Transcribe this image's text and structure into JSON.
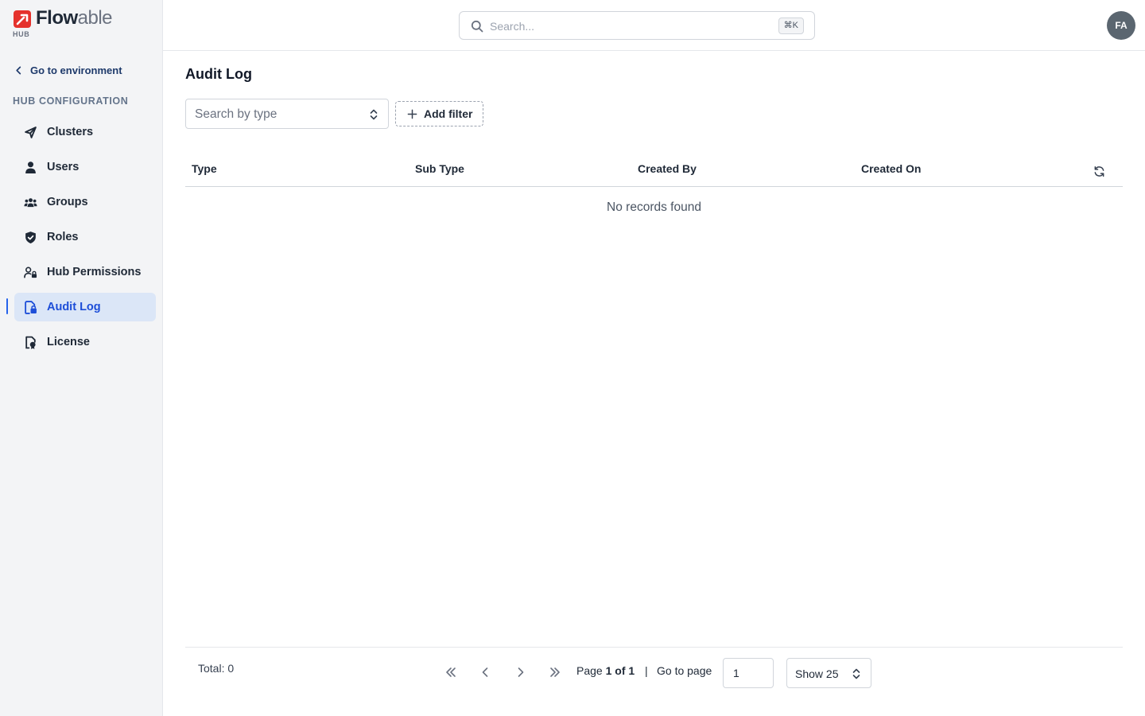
{
  "brand": {
    "name_strong": "Flow",
    "name_soft": "able",
    "sub": "HUB",
    "accent": "#e5322d"
  },
  "sidebar": {
    "back_label": "Go to environment",
    "section_label": "HUB CONFIGURATION",
    "items": [
      {
        "label": "Clusters",
        "icon": "share-nodes-icon",
        "active": false
      },
      {
        "label": "Users",
        "icon": "user-icon",
        "active": false
      },
      {
        "label": "Groups",
        "icon": "users-group-icon",
        "active": false
      },
      {
        "label": "Roles",
        "icon": "shield-check-icon",
        "active": false
      },
      {
        "label": "Hub Permissions",
        "icon": "user-lock-icon",
        "active": false
      },
      {
        "label": "Audit Log",
        "icon": "audit-log-icon",
        "active": true
      },
      {
        "label": "License",
        "icon": "license-icon",
        "active": false
      }
    ],
    "active_color": "#1d4ed8"
  },
  "header": {
    "search_placeholder": "Search...",
    "search_shortcut": "⌘K",
    "avatar_initials": "FA"
  },
  "main": {
    "title": "Audit Log",
    "type_select_placeholder": "Search by type",
    "add_filter_label": "Add filter",
    "table": {
      "columns": [
        "Type",
        "Sub Type",
        "Created By",
        "Created On"
      ],
      "rows": [],
      "empty_message": "No records found"
    },
    "pagination": {
      "total_label": "Total: 0",
      "page_word": "Page",
      "page_current_of_total": "1 of 1",
      "separator": "|",
      "goto_label": "Go to page",
      "goto_value": "1",
      "page_size_label": "Show 25"
    }
  }
}
